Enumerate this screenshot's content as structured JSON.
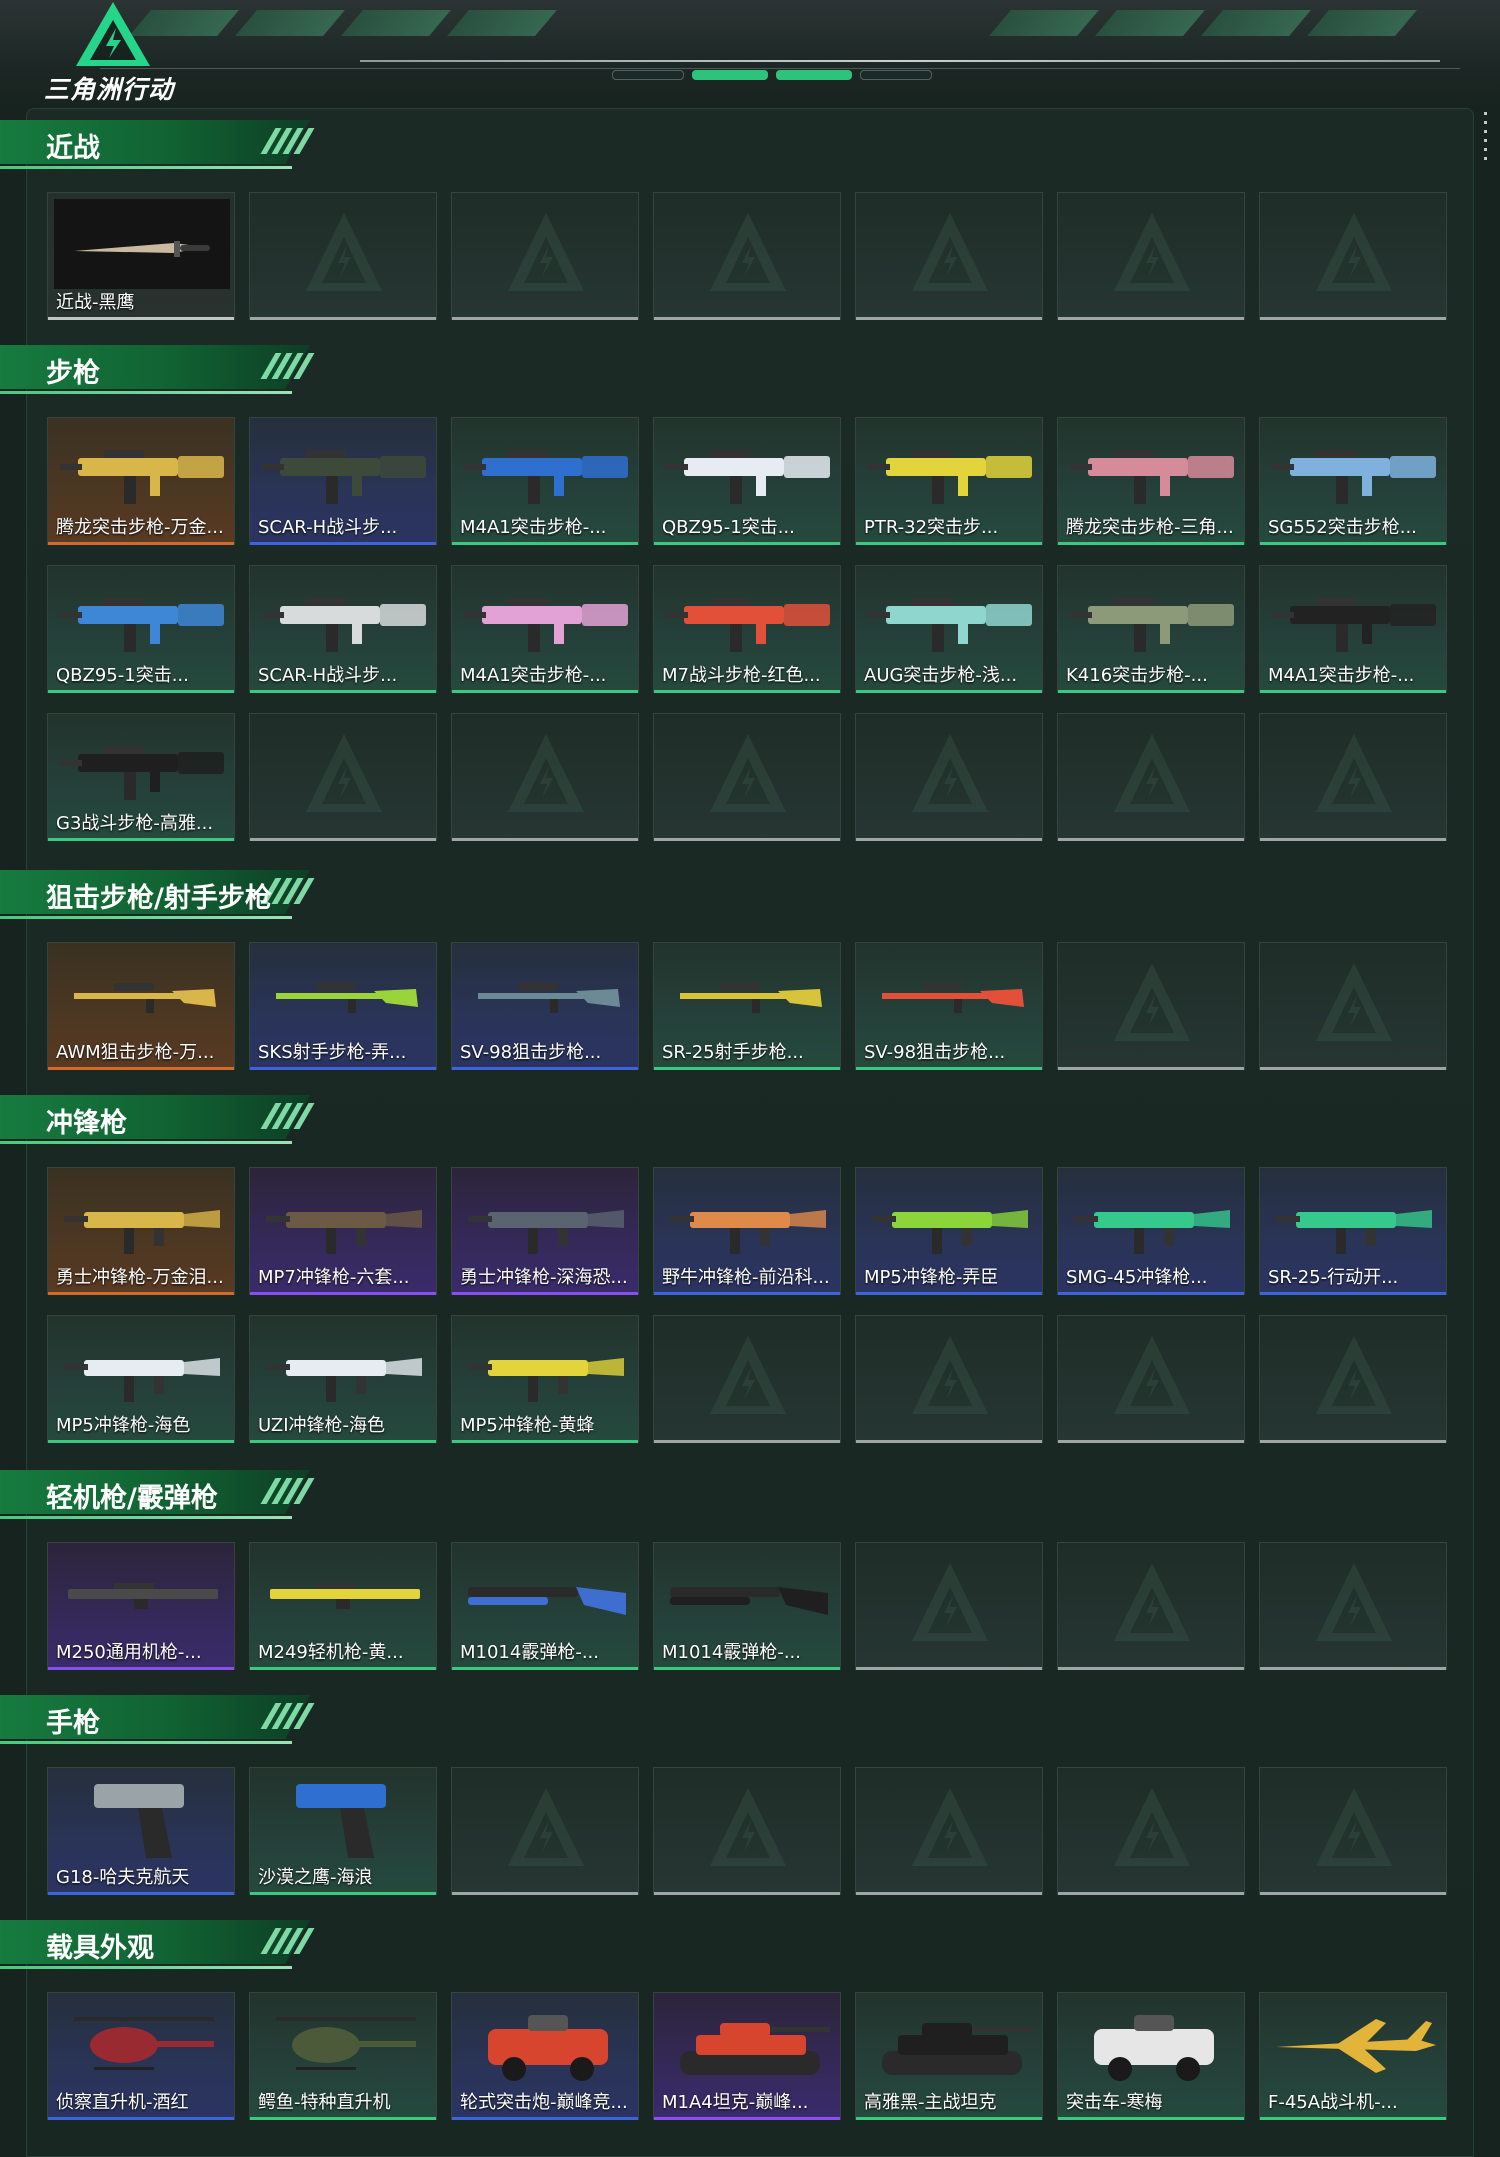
{
  "app": {
    "logo_text": "三角洲行动",
    "pager_count": 4,
    "pager_active": 1
  },
  "colors": {
    "gold": "#d26a2c",
    "blue": "#3f63d8",
    "purple": "#8a4ff0",
    "green": "#39c982",
    "empty": "#9ea7a4"
  },
  "sections": [
    {
      "title": "近战",
      "items": [
        {
          "label": "近战-黑鹰",
          "quality": "dark",
          "icon": "knife-icon",
          "color": "#c9b9a0"
        },
        {
          "label": "",
          "quality": "empty"
        },
        {
          "label": "",
          "quality": "empty"
        },
        {
          "label": "",
          "quality": "empty"
        },
        {
          "label": "",
          "quality": "empty"
        },
        {
          "label": "",
          "quality": "empty"
        },
        {
          "label": "",
          "quality": "empty"
        }
      ]
    },
    {
      "title": "步枪",
      "items": [
        {
          "label": "腾龙突击步枪-万金...",
          "quality": "gold",
          "icon": "rifle-icon",
          "color": "#d9b64a"
        },
        {
          "label": "SCAR-H战斗步...",
          "quality": "blue",
          "icon": "rifle-icon",
          "color": "#3d4a3a"
        },
        {
          "label": "M4A1突击步枪-...",
          "quality": "green",
          "icon": "rifle-icon",
          "color": "#2f6fd0"
        },
        {
          "label": "QBZ95-1突击...",
          "quality": "green",
          "icon": "rifle-icon",
          "color": "#e6ecf2"
        },
        {
          "label": "PTR-32突击步...",
          "quality": "green",
          "icon": "rifle-icon",
          "color": "#e2d43a"
        },
        {
          "label": "腾龙突击步枪-三角...",
          "quality": "green",
          "icon": "rifle-icon",
          "color": "#d68b9a"
        },
        {
          "label": "SG552突击步枪...",
          "quality": "green",
          "icon": "rifle-icon",
          "color": "#7fb1df"
        },
        {
          "label": "QBZ95-1突击...",
          "quality": "green",
          "icon": "rifle-icon",
          "color": "#3e86d6"
        },
        {
          "label": "SCAR-H战斗步...",
          "quality": "green",
          "icon": "rifle-icon",
          "color": "#d7dbdc"
        },
        {
          "label": "M4A1突击步枪-...",
          "quality": "green",
          "icon": "rifle-icon",
          "color": "#e3a2d6"
        },
        {
          "label": "M7战斗步枪-红色...",
          "quality": "green",
          "icon": "rifle-icon",
          "color": "#e2503a"
        },
        {
          "label": "AUG突击步枪-浅...",
          "quality": "green",
          "icon": "rifle-icon",
          "color": "#8fd6cf"
        },
        {
          "label": "K416突击步枪-...",
          "quality": "green",
          "icon": "rifle-icon",
          "color": "#8d9a79"
        },
        {
          "label": "M4A1突击步枪-...",
          "quality": "green",
          "icon": "rifle-icon",
          "color": "#222222"
        },
        {
          "label": "G3战斗步枪-高雅...",
          "quality": "green",
          "icon": "rifle-icon",
          "color": "#1f1f1f"
        },
        {
          "label": "",
          "quality": "empty"
        },
        {
          "label": "",
          "quality": "empty"
        },
        {
          "label": "",
          "quality": "empty"
        },
        {
          "label": "",
          "quality": "empty"
        },
        {
          "label": "",
          "quality": "empty"
        },
        {
          "label": "",
          "quality": "empty"
        }
      ]
    },
    {
      "title": "狙击步枪/射手步枪",
      "items": [
        {
          "label": "AWM狙击步枪-万...",
          "quality": "gold",
          "icon": "sniper-icon",
          "color": "#d9b64a"
        },
        {
          "label": "SKS射手步枪-弄...",
          "quality": "blue",
          "icon": "sniper-icon",
          "color": "#9bd43a"
        },
        {
          "label": "SV-98狙击步枪...",
          "quality": "blue",
          "icon": "sniper-icon",
          "color": "#6c8a95"
        },
        {
          "label": "SR-25射手步枪...",
          "quality": "green",
          "icon": "sniper-icon",
          "color": "#d8c43a"
        },
        {
          "label": "SV-98狙击步枪...",
          "quality": "green",
          "icon": "sniper-icon",
          "color": "#e2503a"
        },
        {
          "label": "",
          "quality": "empty"
        },
        {
          "label": "",
          "quality": "empty"
        }
      ]
    },
    {
      "title": "冲锋枪",
      "items": [
        {
          "label": "勇士冲锋枪-万金泪...",
          "quality": "gold",
          "icon": "smg-icon",
          "color": "#d9b64a"
        },
        {
          "label": "MP7冲锋枪-六套...",
          "quality": "purple",
          "icon": "smg-icon",
          "color": "#6b5a44"
        },
        {
          "label": "勇士冲锋枪-深海恐...",
          "quality": "purple",
          "icon": "smg-icon",
          "color": "#5a6470"
        },
        {
          "label": "野牛冲锋枪-前沿科...",
          "quality": "blue",
          "icon": "smg-icon",
          "color": "#e08a4a"
        },
        {
          "label": "MP5冲锋枪-弄臣",
          "quality": "blue",
          "icon": "smg-icon",
          "color": "#8bd43a"
        },
        {
          "label": "SMG-45冲锋枪...",
          "quality": "blue",
          "icon": "smg-icon",
          "color": "#36c98c"
        },
        {
          "label": "SR-25-行动开...",
          "quality": "blue",
          "icon": "smg-icon",
          "color": "#36c98c"
        },
        {
          "label": "MP5冲锋枪-海色",
          "quality": "green",
          "icon": "smg-icon",
          "color": "#e6ecf2"
        },
        {
          "label": "UZI冲锋枪-海色",
          "quality": "green",
          "icon": "smg-icon",
          "color": "#e6ecf2"
        },
        {
          "label": "MP5冲锋枪-黄蜂",
          "quality": "green",
          "icon": "smg-icon",
          "color": "#e2d43a"
        },
        {
          "label": "",
          "quality": "empty"
        },
        {
          "label": "",
          "quality": "empty"
        },
        {
          "label": "",
          "quality": "empty"
        },
        {
          "label": "",
          "quality": "empty"
        }
      ]
    },
    {
      "title": "轻机枪/霰弹枪",
      "items": [
        {
          "label": "M250通用机枪-...",
          "quality": "purple",
          "icon": "lmg-icon",
          "color": "#4a4a4a"
        },
        {
          "label": "M249轻机枪-黄...",
          "quality": "green",
          "icon": "lmg-icon",
          "color": "#e2d43a"
        },
        {
          "label": "M1014霰弹枪-...",
          "quality": "green",
          "icon": "shotgun-icon",
          "color": "#3e6fd0"
        },
        {
          "label": "M1014霰弹枪-...",
          "quality": "green",
          "icon": "shotgun-icon",
          "color": "#1f1f1f"
        },
        {
          "label": "",
          "quality": "empty"
        },
        {
          "label": "",
          "quality": "empty"
        },
        {
          "label": "",
          "quality": "empty"
        }
      ]
    },
    {
      "title": "手枪",
      "items": [
        {
          "label": "G18-哈夫克航天",
          "quality": "blue",
          "icon": "pistol-icon",
          "color": "#9aa3a8"
        },
        {
          "label": "沙漠之鹰-海浪",
          "quality": "green",
          "icon": "pistol-icon",
          "color": "#2f6fd0"
        },
        {
          "label": "",
          "quality": "empty"
        },
        {
          "label": "",
          "quality": "empty"
        },
        {
          "label": "",
          "quality": "empty"
        },
        {
          "label": "",
          "quality": "empty"
        },
        {
          "label": "",
          "quality": "empty"
        }
      ]
    },
    {
      "title": "载具外观",
      "items": [
        {
          "label": "侦察直升机-酒红",
          "quality": "blue",
          "icon": "helicopter-icon",
          "color": "#9a2a32"
        },
        {
          "label": "鳄鱼-特种直升机",
          "quality": "green",
          "icon": "helicopter-icon",
          "color": "#4d5a3a"
        },
        {
          "label": "轮式突击炮-巅峰竞...",
          "quality": "blue",
          "icon": "armored-car-icon",
          "color": "#d8452f"
        },
        {
          "label": "M1A4坦克-巅峰...",
          "quality": "purple",
          "icon": "tank-icon",
          "color": "#d8452f"
        },
        {
          "label": "高雅黑-主战坦克",
          "quality": "green",
          "icon": "tank-icon",
          "color": "#1f1f1f"
        },
        {
          "label": "突击车-寒梅",
          "quality": "green",
          "icon": "armored-car-icon",
          "color": "#e6e6e6"
        },
        {
          "label": "F-45A战斗机-...",
          "quality": "green",
          "icon": "jet-icon",
          "color": "#e2b43a"
        }
      ]
    }
  ]
}
